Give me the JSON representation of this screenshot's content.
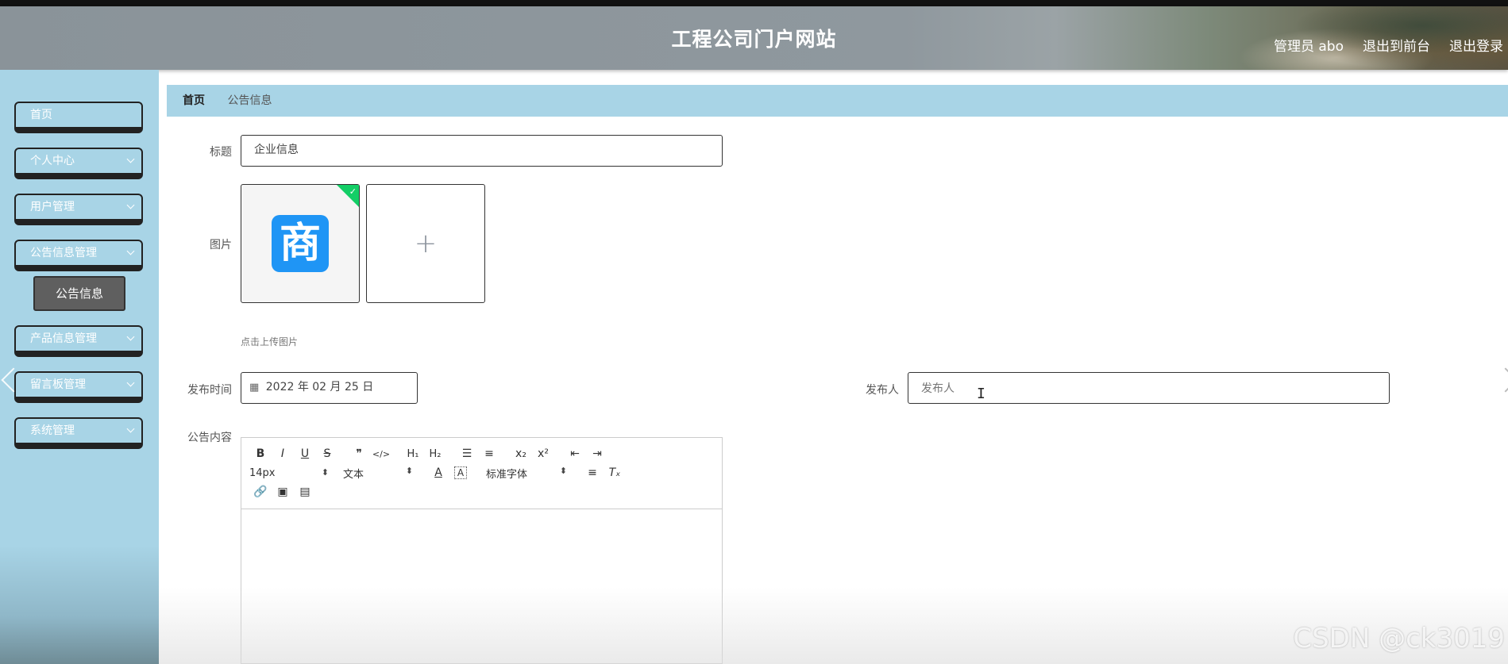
{
  "header": {
    "title": "工程公司门户网站",
    "user": "管理员 abo",
    "front_link": "退出到前台",
    "logout": "退出登录"
  },
  "sidebar": {
    "items": [
      {
        "label": "首页"
      },
      {
        "label": "个人中心"
      },
      {
        "label": "用户管理"
      },
      {
        "label": "公告信息管理"
      },
      {
        "label": "产品信息管理"
      },
      {
        "label": "留言板管理"
      },
      {
        "label": "系统管理"
      }
    ],
    "subitem": "公告信息"
  },
  "breadcrumb": {
    "home": "首页",
    "current": "公告信息"
  },
  "form": {
    "title_label": "标题",
    "title_value": "企业信息",
    "image_label": "图片",
    "upload_hint": "点击上传图片",
    "image_glyph": "商",
    "date_label": "发布时间",
    "date_value": "2022 年 02 月 25 日",
    "publisher_label": "发布人",
    "publisher_placeholder": "发布人",
    "content_label": "公告内容"
  },
  "editor": {
    "font_size": "14px",
    "block_type": "文本",
    "font_family": "标准字体"
  },
  "watermark": "CSDN @ck3019"
}
